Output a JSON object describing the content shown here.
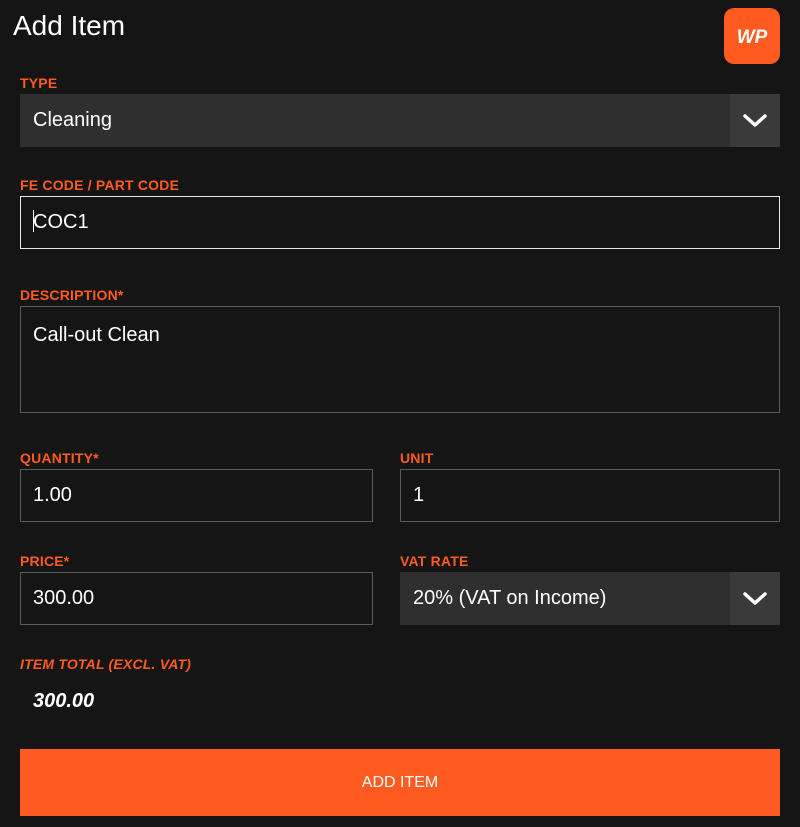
{
  "header": {
    "title": "Add Item",
    "logo_text": "WP",
    "accent_color": "#ff5a1f"
  },
  "form": {
    "type": {
      "label": "TYPE",
      "value": "Cleaning"
    },
    "code": {
      "label": "FE CODE / PART CODE",
      "value": "COC1"
    },
    "description": {
      "label": "DESCRIPTION*",
      "value": "Call-out Clean"
    },
    "quantity": {
      "label": "QUANTITY*",
      "value": "1.00"
    },
    "unit": {
      "label": "UNIT",
      "value": "1"
    },
    "price": {
      "label": "PRICE*",
      "value": "300.00"
    },
    "vat_rate": {
      "label": "VAT RATE",
      "value": "20% (VAT on Income)"
    },
    "item_total": {
      "label": "ITEM TOTAL (EXCL. VAT)",
      "value": "300.00"
    },
    "submit_label": "ADD ITEM"
  },
  "icons": {
    "dropdown": "chevron-down-icon",
    "logo": "wp-logo-icon"
  }
}
